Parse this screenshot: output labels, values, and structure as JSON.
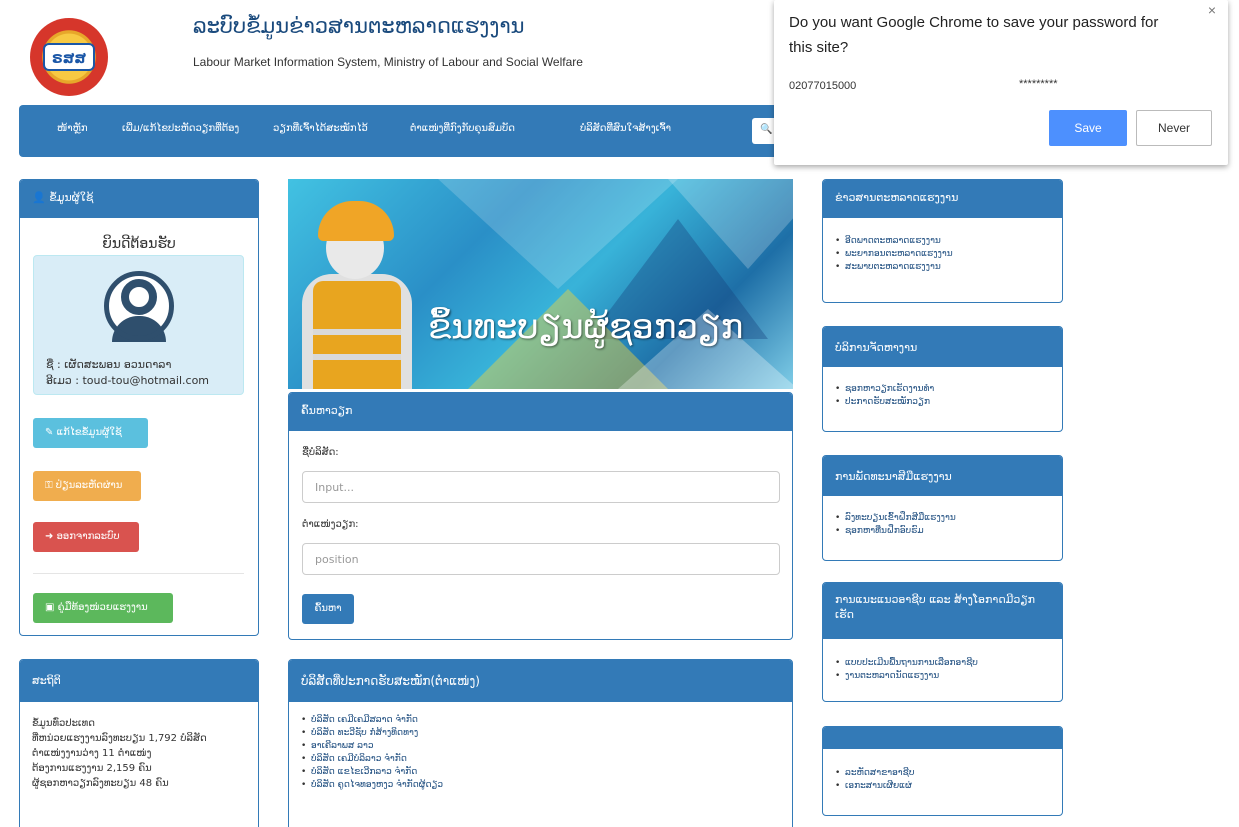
{
  "header": {
    "logo_text": "ຣສສ",
    "title_lao": "ລະບົບຂໍ້ມູນຂ່າວສານຕະຫລາດແຮງງານ",
    "title_en": "Labour Market Information System, Ministry of Labour and Social Welfare"
  },
  "nav": {
    "items": [
      "ໜ້າຫຼັກ",
      "ເພີ່ມ/ແກ້ໄຂປະຫັດວຽກທີ່ຕ້ອງ",
      "ວຽກທີ່ເຈົ້າໄດ້ສະໝັກໄວ້",
      "ຕຳແໜ່ງທີ່ກົງກັບຄຸນສົມບັດ",
      "ບໍລິສັດທີ່ສົນໃຈສ້າງເຈົ້າ"
    ],
    "search_label": "ຄົ"
  },
  "password_prompt": {
    "question": "Do you want Google Chrome to save your password for this site?",
    "close_icon": "×",
    "username": "02077015000",
    "password_mask": "*********",
    "save_label": "Save",
    "never_label": "Never"
  },
  "user_panel": {
    "title": "ຂໍ້ມູນຜູ້ໃຊ້",
    "welcome": "ຍິນດີຕ້ອນຮັບ",
    "name_line": "ຊື່ : ເຜັດສະພອນ ອວນດາລາ",
    "email_line": "ອີເມວ : toud-tou@hotmail.com",
    "buttons": {
      "edit": "ແກ້ໄຂຂໍ້ມູນຜູ້ໃຊ້",
      "password": "ປ່ຽນລະຫັດຜ່ານ",
      "logout": "ອອກຈາກລະບົບ",
      "manual": "ຄູ່ມືທ້ອງໜ່ວຍແຮງງານ"
    },
    "colors": {
      "edit": "#5bc0de",
      "password": "#f0ad4e",
      "logout": "#d9534f",
      "manual": "#5cb85c"
    }
  },
  "stats_panel": {
    "title": "ສະຖິຕິ",
    "lines": [
      "ຂໍ້ມູນທົ່ວປະເທດ",
      "ທີ່ຫນ່ວຍແຮງງານລົງທະບຽນ 1,792 ບໍລິສັດ",
      "ຕຳແໜ່ງງານວ່າງ 11 ຕຳແໜ່ງ",
      "ຕ້ອງການແຮງງານ 2,159 ຄົນ",
      "ຜູ້ຊອກຫາວຽກລົງທະບຽນ 48 ຄົນ"
    ]
  },
  "banner": {
    "text": "ຂຶ້ນທະບຽນຜູ້ຊອກວຽກ"
  },
  "search_panel": {
    "title": "ຄົ້ນຫາວຽກ",
    "company_label": "ຊື່ບໍລິສັດ:",
    "company_placeholder": "Input...",
    "position_label": "ຕຳແໜ່ງວຽກ:",
    "position_placeholder": "position",
    "search_button": "ຄົ້ນຫາ"
  },
  "companies_panel": {
    "title": "ບໍລິສັດທີ່ປະກາດຮັບສະໝັກ(ຕຳແໜ່ງ)",
    "items": [
      "ບໍລິສັດ ເຄມີເຄມີສລາດ ຈຳກັດ",
      "ບໍລິສັດ ທະວີຊັບ ກໍ່ສ້າງທິດທາງ",
      "ອາເຄີລາພສ ລາວ",
      "ບໍລິສັດ ເຄມີບໍລິລາວ ຈຳກັດ",
      "ບໍລິສັດ ແຂໄຂເວີກລາວ ຈຳກັດ",
      "ບໍລິສັດ ຄູດໄຈທອງຫງວ ຈຳກັດຜູ້ດຽວ"
    ]
  },
  "right_panels": [
    {
      "title": "ຂ່າວສານຕະຫລາດແຮງງານ",
      "items": [
        "ອີດພາດຕະຫລາດແຮງງານ",
        "ພະຍາກອນຕະຫລາດແຮງງານ",
        "ສະພາບຕະຫລາດແຮງງານ"
      ]
    },
    {
      "title": "ບໍລິການຈັດຫາງານ",
      "items": [
        "ຊອກຫາວຽກເຮັດງານທຳ",
        "ປະກາດຮັບສະໝັກວຽກ"
      ]
    },
    {
      "title": "ການພັດທະນາສີມືແຮງງານ",
      "items": [
        "ລົງທະບຽນເຂົ້າຝຶກສີມືແຮງງານ",
        "ຊອກຫາທີ່ນຝຶກອົບຮົມ"
      ]
    },
    {
      "title": "ການແນະແນວອາຊີບ ແລະ ສ້າງໂອກາດມີວຽກເຮັດ",
      "items": [
        "ແບບປະເມີນພື້ນຖານການເລືອກອາຊີບ",
        "ງານຕະຫລາດນັດແຮງງານ"
      ]
    },
    {
      "title": "",
      "items": [
        "ລະຫັດສາຂາອາຊີບ",
        "ເອກະສານເຜີຍແຜ່"
      ]
    }
  ]
}
